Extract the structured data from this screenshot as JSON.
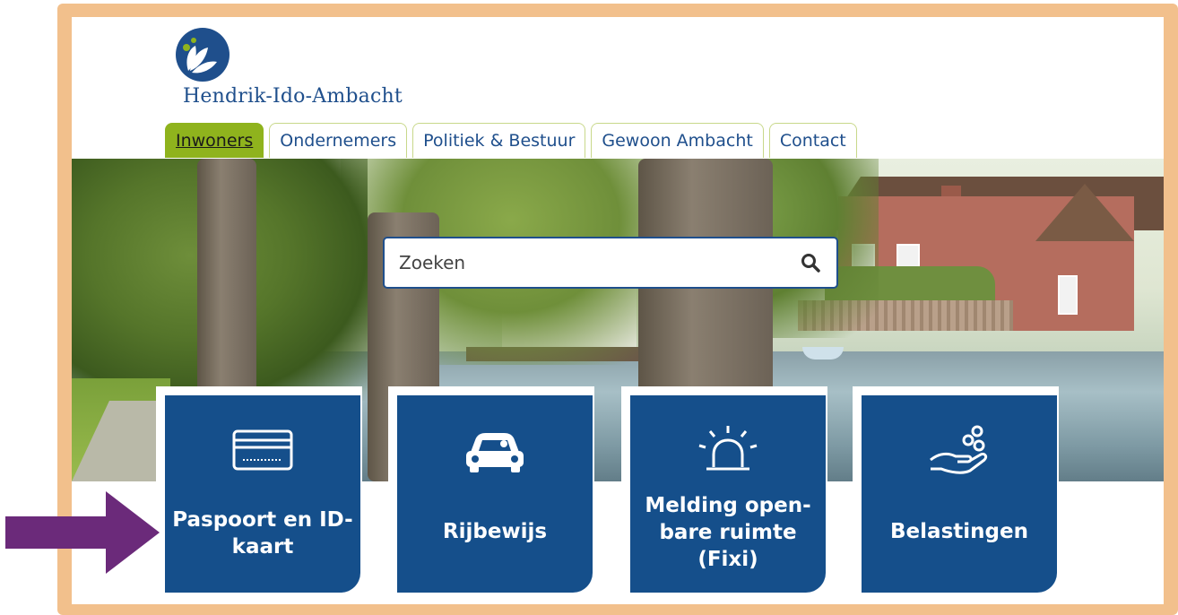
{
  "site": {
    "name": "Hendrik-Ido-Ambacht"
  },
  "nav": {
    "tabs": [
      {
        "label": "Inwoners",
        "active": true
      },
      {
        "label": "Ondernemers",
        "active": false
      },
      {
        "label": "Politiek & Bestuur",
        "active": false
      },
      {
        "label": "Gewoon Ambacht",
        "active": false
      },
      {
        "label": "Contact",
        "active": false
      }
    ]
  },
  "search": {
    "placeholder": "Zoeken",
    "icon": "search-icon"
  },
  "tiles": [
    {
      "label": "Paspoort en ID-\nkaart",
      "icon": "id-card-icon"
    },
    {
      "label": "Rijbewijs",
      "icon": "car-icon"
    },
    {
      "label": "Melding open-\nbare ruimte\n(Fixi)",
      "icon": "alarm-light-icon"
    },
    {
      "label": "Belastingen",
      "icon": "hand-coins-icon"
    }
  ],
  "colors": {
    "frame": "#f2c08c",
    "primary": "#154f8b",
    "active_tab": "#8fb31d",
    "arrow": "#6b2a7a"
  }
}
